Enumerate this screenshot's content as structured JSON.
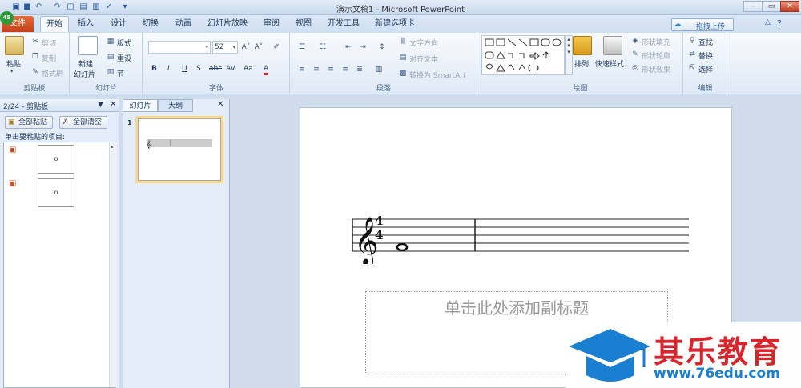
{
  "window": {
    "title": "演示文稿1 - Microsoft PowerPoint",
    "logo_text": "45"
  },
  "tabs": [
    "文件",
    "开始",
    "插入",
    "设计",
    "切换",
    "动画",
    "幻灯片放映",
    "审阅",
    "视图",
    "开发工具",
    "新建选项卡"
  ],
  "upload_label": "拖拽上传",
  "ribbon": {
    "clipboard": {
      "paste": "粘贴",
      "cut": "剪切",
      "copy": "复制",
      "format_painter": "格式刷",
      "label": "剪贴板"
    },
    "slides": {
      "new_slide": "新建",
      "new_slide2": "幻灯片",
      "layout": "版式",
      "reset": "重设",
      "section": "节",
      "label": "幻灯片"
    },
    "font": {
      "font_size": "52",
      "bold": "B",
      "italic": "I",
      "underline": "U",
      "shadow": "S",
      "strike": "abc",
      "spacing": "AV",
      "case": "Aa",
      "color": "A",
      "label": "字体"
    },
    "paragraph": {
      "text_direction": "文字方向",
      "align_text": "对齐文本",
      "smartart": "转换为 SmartArt",
      "label": "段落"
    },
    "drawing": {
      "arrange": "排列",
      "quick_styles": "快速样式",
      "shape_fill": "形状填充",
      "shape_outline": "形状轮廓",
      "shape_effects": "形状效果",
      "label": "绘图"
    },
    "editing": {
      "find": "查找",
      "replace": "替换",
      "select": "选择",
      "label": "编辑"
    }
  },
  "clipboard_pane": {
    "title": "2/24 - 剪贴板",
    "paste_all": "全部粘贴",
    "clear_all": "全部清空",
    "instruction": "单击要粘贴的项目:"
  },
  "slides_pane": {
    "tab_slides": "幻灯片",
    "tab_outline": "大纲",
    "slide_number": "1"
  },
  "slide": {
    "time_sig_top": "4",
    "time_sig_bottom": "4",
    "subtitle_placeholder": "单击此处添加副标题"
  },
  "watermark": {
    "title": "其乐教育",
    "url": "www.76edu.com"
  }
}
